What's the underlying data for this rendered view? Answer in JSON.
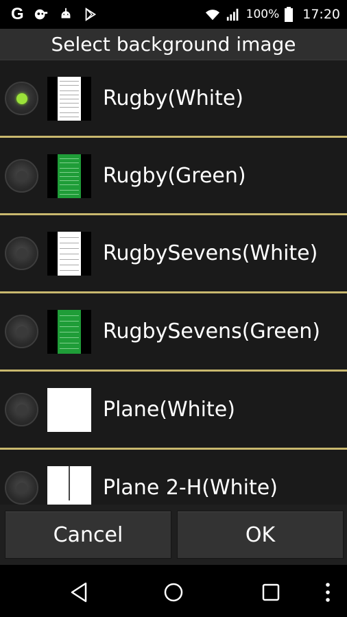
{
  "status_bar": {
    "icons": [
      "google-g-icon",
      "weather-cloud-icon",
      "android-debug-icon",
      "play-store-icon",
      "wifi-icon",
      "signal-icon",
      "battery-icon"
    ],
    "g_letter": "G",
    "battery_percent": "100%",
    "time": "17:20"
  },
  "dialog": {
    "title": "Select background image",
    "items": [
      {
        "label": "Rugby(White)",
        "selected": true,
        "thumbnail": "rugby-field-white"
      },
      {
        "label": "Rugby(Green)",
        "selected": false,
        "thumbnail": "rugby-field-green"
      },
      {
        "label": "RugbySevens(White)",
        "selected": false,
        "thumbnail": "rugby-sevens-field-white"
      },
      {
        "label": "RugbySevens(Green)",
        "selected": false,
        "thumbnail": "rugby-sevens-field-green"
      },
      {
        "label": "Plane(White)",
        "selected": false,
        "thumbnail": "plane-white"
      },
      {
        "label": "Plane 2-H(White)",
        "selected": false,
        "thumbnail": "plane-2h-white"
      }
    ],
    "cancel_label": "Cancel",
    "ok_label": "OK"
  },
  "nav_bar": {
    "buttons": [
      "back-icon",
      "home-icon",
      "recents-icon",
      "menu-icon"
    ]
  },
  "colors": {
    "divider": "#c9b86e",
    "radio_checked": "#9be23a",
    "field_green": "#1f9d38"
  }
}
